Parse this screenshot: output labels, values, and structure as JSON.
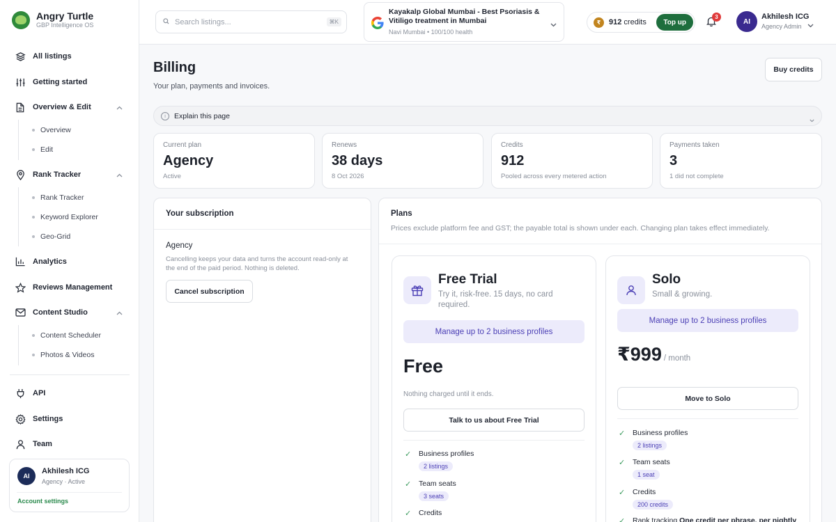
{
  "app": {
    "name": "Angry Turtle",
    "tagline": "GBP Intelligence OS"
  },
  "sidebar": {
    "items": [
      {
        "label": "All listings",
        "icon": "layers-icon"
      },
      {
        "label": "Getting started",
        "icon": "sliders-icon"
      },
      {
        "label": "Overview & Edit",
        "icon": "document-icon",
        "children": [
          "Overview",
          "Edit"
        ]
      },
      {
        "label": "Rank Tracker",
        "icon": "pin-icon",
        "children": [
          "Rank Tracker",
          "Keyword Explorer",
          "Geo-Grid"
        ]
      },
      {
        "label": "Analytics",
        "icon": "bar-chart-icon"
      },
      {
        "label": "Reviews Management",
        "icon": "star-icon"
      },
      {
        "label": "Content Studio",
        "icon": "mail-icon",
        "children": [
          "Content Scheduler",
          "Photos & Videos"
        ]
      },
      {
        "label": "API",
        "icon": "plug-icon"
      },
      {
        "label": "Settings",
        "icon": "gear-icon"
      },
      {
        "label": "Team",
        "icon": "person-icon"
      }
    ],
    "user": {
      "initials": "AI",
      "name": "Akhilesh ICG",
      "role": "Agency · Active",
      "link": "Account settings"
    }
  },
  "topbar": {
    "search_placeholder": "Search listings...",
    "search_shortcut": "⌘K",
    "listing": {
      "title": "Kayakalp Global Mumbai - Best Psoriasis & Vitiligo treatment in Mumbai",
      "sub": "Navi Mumbai • 100/100 health"
    },
    "credits": {
      "coin": "₹",
      "amount": "912",
      "unit": "credits",
      "topup": "Top up"
    },
    "notifications": "3",
    "user": {
      "initials": "AI",
      "name": "Akhilesh ICG",
      "role": "Agency Admin"
    }
  },
  "page": {
    "title": "Billing",
    "subtitle": "Your plan, payments and invoices.",
    "buy_credits": "Buy credits",
    "explain": "Explain this page"
  },
  "stats": [
    {
      "label": "Current plan",
      "value": "Agency",
      "sub": "Active"
    },
    {
      "label": "Renews",
      "value": "38 days",
      "sub": "8 Oct 2026"
    },
    {
      "label": "Credits",
      "value": "912",
      "sub": "Pooled across every metered action"
    },
    {
      "label": "Payments taken",
      "value": "3",
      "sub": "1 did not complete"
    }
  ],
  "subscription": {
    "title": "Your subscription",
    "plan": "Agency",
    "note": "Cancelling keeps your data and turns the account read-only at the end of the paid period. Nothing is deleted.",
    "cancel": "Cancel subscription"
  },
  "plans": {
    "title": "Plans",
    "note": "Prices exclude platform fee and GST; the payable total is shown under each. Changing plan takes effect immediately.",
    "cards": [
      {
        "name": "Free Trial",
        "icon": "gift-icon",
        "tagline": "Try it, risk-free. 15 days, no card required.",
        "cap": "Manage up to 2 business profiles",
        "price": "Free",
        "per": "",
        "price_note": "Nothing charged until it ends.",
        "button": "Talk to us about Free Trial",
        "features": [
          {
            "label": "Business profiles",
            "badge": "2 listings"
          },
          {
            "label": "Team seats",
            "badge": "3 seats"
          },
          {
            "label": "Credits",
            "badge": ""
          }
        ]
      },
      {
        "name": "Solo",
        "icon": "user-icon",
        "tagline": "Small & growing.",
        "cap": "Manage up to 2 business profiles",
        "price": "₹999",
        "per": "/ month",
        "price_note": "",
        "button": "Move to Solo",
        "features": [
          {
            "label": "Business profiles",
            "badge": "2 listings"
          },
          {
            "label": "Team seats",
            "badge": "1 seat"
          },
          {
            "label": "Credits",
            "badge": "200 credits"
          },
          {
            "label": "Rank tracking",
            "bold": "One credit per phrase, per nightly",
            "badge": ""
          }
        ]
      }
    ]
  }
}
